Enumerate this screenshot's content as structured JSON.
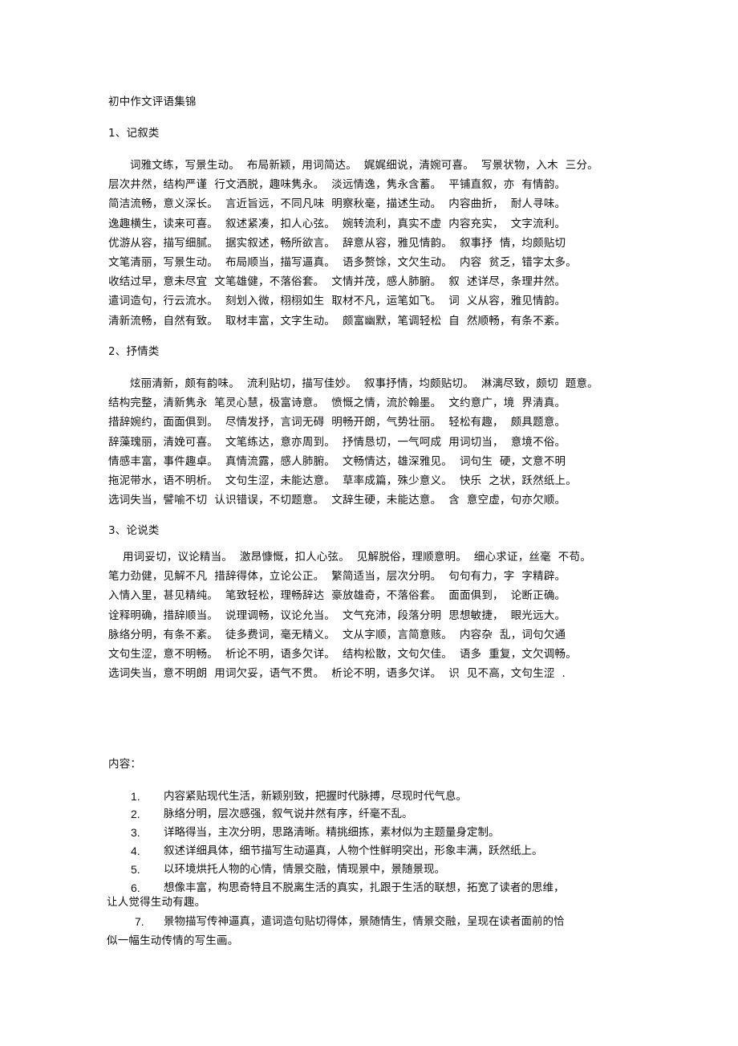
{
  "document": {
    "title": "初中作文评语集锦",
    "sections": [
      {
        "heading": "1、记叙类",
        "lines": [
          "      词雅文练，写景生动。  布局新颖，用词简达。  娓娓细说，清婉可喜。  写景状物，入木  三分。",
          "层次井然，结构严谨  行文洒脱，趣味隽永。  淡远情逸，隽永含蓄。  平铺直叙，亦  有情韵。",
          "简洁流畅，意义深长。  言近旨远，不同凡味  明察秋毫，描述生动。  内容曲折，  耐人寻味。",
          "逸趣横生，读来可喜。  叙述紧凑，扣人心弦。  婉转流利，真实不虚  内容充实，  文字流利。",
          "优游从容，描写细腻。  据实叙述，畅所欲言。  辞意从容，雅见情韵。  叙事抒  情，均颇贴切",
          "文笔清丽，写景生动。  布局顺当，描写逼真。  语多赘馀，文欠生动。  内容  贫乏，错字太多。",
          "收结过早，意未尽宜  文笔雄健，不落俗套。  文情并茂，感人肺腑。  叙  述详尽，条理井然。",
          "遣词造句，行云流水。  刻划入微，栩栩如生  取材不凡，运笔如飞。  词  义从容，雅见情韵。",
          "清新流畅，自然有致。  取材丰富，文字生动。  颇富幽默，笔调轻松  自  然顺畅，有条不紊。"
        ]
      },
      {
        "heading": "2、抒情类",
        "lines": [
          "      炫丽清新，颇有韵味。  流利贴切，描写佳妙。  叙事抒情，均颇贴切。  淋漓尽致，颇切  题意。",
          "结构完整，清新隽永  笔灵心慧，极富诗意。  愤慨之情，流於翰墨。  文约意广，境  界清真。",
          "措辞婉约，面面俱到。  尽情发抒，言词无碍  明畅开朗，气势壮丽。  轻松有趣，  颇具题意。",
          "辞藻瑰丽，清娩可喜。  文笔练达，意亦周到。  抒情恳切，一气呵成  用词切当，  意境不俗。",
          "情感丰富，事件趣卓。  真情流露，感人肺腑。  文畅情达，雄深雅见。  词句生  硬，文意不明",
          "拖泥带水，语不明析。  文句生涩，未能达意。  草率成篇，殊少意义。  快乐  之状，跃然纸上。",
          "选词失当，譬喻不切  认识错误，不切题意。  文辞生硬，未能达意。  含  意空虚，句亦欠顺。"
        ]
      },
      {
        "heading": "3、论说类",
        "lines": [
          "    用词妥切，议论精当。  激昂慷慨，扣人心弦。  见解脱俗，理顺意明。  细心求证，丝毫  不苟。",
          "笔力劲健，见解不凡  措辞得体，立论公正。  繁简适当，层次分明。  句句有力，字  字精辟。",
          "入情入里，甚见精纯。  笔致轻松，理畅辞达  豪放雄奇，不落俗套。  面面俱到，  论断正确。",
          "诠释明确，措辞顺当。  说理调畅，议论允当。  文气充沛，段落分明  思想敏捷，  眼光远大。",
          "脉络分明，有条不紊。  徒多费词，毫无精义。  文从字顺，言简意赅。  内容杂  乱，词句欠通",
          "文句生涩，意不明畅。  析论不明，语多欠详。  结构松散，文句欠佳。  语多  重复，文欠调畅。",
          "选词失当，意不明朗  用词欠妥，语气不贯。  析论不明，语多欠详。  识  见不高，文句生涩  ."
        ]
      }
    ],
    "content_label": "内容：",
    "content_items": [
      {
        "num": "1.",
        "text": "内容紧贴现代生活，新颖别致，把握时代脉搏，尽现时代气息。"
      },
      {
        "num": "2.",
        "text": "脉络分明，层次感强，叙气说井然有序，纤毫不乱。"
      },
      {
        "num": "3.",
        "text": "详略得当，主次分明，思路清晰。精挑细拣，素材似为主题量身定制。"
      },
      {
        "num": "4.",
        "text": "叙述详细具体，细节描写生动逼真，人物个性鲜明突出，形象丰满，跃然纸上。"
      },
      {
        "num": "5.",
        "text": "以环境烘托人物的心情，情景交融，情现景中，景随景现。"
      },
      {
        "num": "6.",
        "text": "想像丰富，构思奇特且不脱离生活的真实，扎跟于生活的联想，拓宽了读者的思维，",
        "cont": "让人觉得生动有趣。"
      },
      {
        "num": "7.",
        "text": "景物描写传神逼真，遣词造句贴切得体，景随情生，情景交融，呈现在读者面前的恰",
        "cont": "似一幅生动传情的写生画。"
      }
    ]
  }
}
